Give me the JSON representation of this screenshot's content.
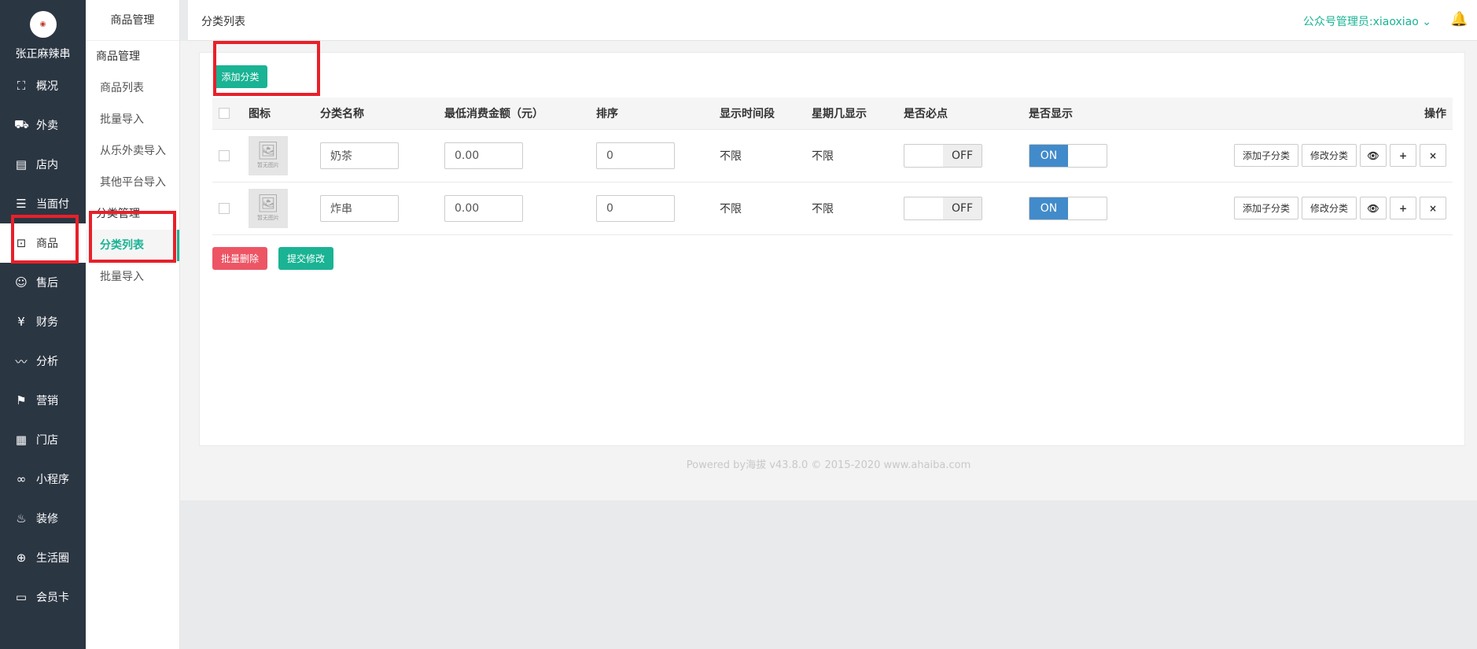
{
  "brand": {
    "logo_text": "张正麻辣串",
    "store_name": "张正麻辣串"
  },
  "nav": [
    {
      "label": "概况",
      "icon": "overview-icon",
      "glyph": "⛶"
    },
    {
      "label": "外卖",
      "icon": "delivery-icon",
      "glyph": "⛟"
    },
    {
      "label": "店内",
      "icon": "store-icon",
      "glyph": "▤"
    },
    {
      "label": "当面付",
      "icon": "bill-icon",
      "glyph": "☰"
    },
    {
      "label": "商品",
      "icon": "bag-icon",
      "glyph": "⊡"
    },
    {
      "label": "售后",
      "icon": "service-icon",
      "glyph": "☺"
    },
    {
      "label": "财务",
      "icon": "yen-icon",
      "glyph": "¥"
    },
    {
      "label": "分析",
      "icon": "chart-icon",
      "glyph": "〰"
    },
    {
      "label": "营销",
      "icon": "flag-icon",
      "glyph": "⚑"
    },
    {
      "label": "门店",
      "icon": "shop-icon",
      "glyph": "▦"
    },
    {
      "label": "小程序",
      "icon": "miniapp-icon",
      "glyph": "∞"
    },
    {
      "label": "装修",
      "icon": "fire-icon",
      "glyph": "♨"
    },
    {
      "label": "生活圈",
      "icon": "globe-icon",
      "glyph": "⊕"
    },
    {
      "label": "会员卡",
      "icon": "card-icon",
      "glyph": "▭"
    }
  ],
  "subnav": {
    "head": "商品管理",
    "group1": "商品管理",
    "group1_items": [
      "商品列表",
      "批量导入",
      "从乐外卖导入",
      "其他平台导入"
    ],
    "group2": "分类管理",
    "group2_items": [
      "分类列表",
      "批量导入"
    ]
  },
  "header": {
    "title": "分类列表",
    "admin": "公众号管理员:xiaoxiao ⌄"
  },
  "toolbar": {
    "add_label": "添加分类"
  },
  "table": {
    "headers": [
      "图标",
      "分类名称",
      "最低消费金额（元）",
      "排序",
      "显示时间段",
      "星期几显示",
      "是否必点",
      "是否显示",
      "操作"
    ],
    "placeholder_text": "暂无图片",
    "rows": [
      {
        "name": "奶茶",
        "min_amount": "0.00",
        "sort": "0",
        "time": "不限",
        "weekday": "不限",
        "required": "OFF",
        "visible": "ON"
      },
      {
        "name": "炸串",
        "min_amount": "0.00",
        "sort": "0",
        "time": "不限",
        "weekday": "不限",
        "required": "OFF",
        "visible": "ON"
      }
    ],
    "ops": {
      "add_child": "添加子分类",
      "edit": "修改分类",
      "view": "👁",
      "plus": "+",
      "del": "×"
    }
  },
  "actions": {
    "batch_delete": "批量删除",
    "submit": "提交修改"
  },
  "footer": "Powered by海拔 v43.8.0 © 2015-2020 www.ahaiba.com",
  "colors": {
    "accent": "#1ab394",
    "danger": "#ed5565",
    "toggle_on": "#428bca",
    "sidebar": "#2b3643",
    "highlight": "#e8202a"
  }
}
